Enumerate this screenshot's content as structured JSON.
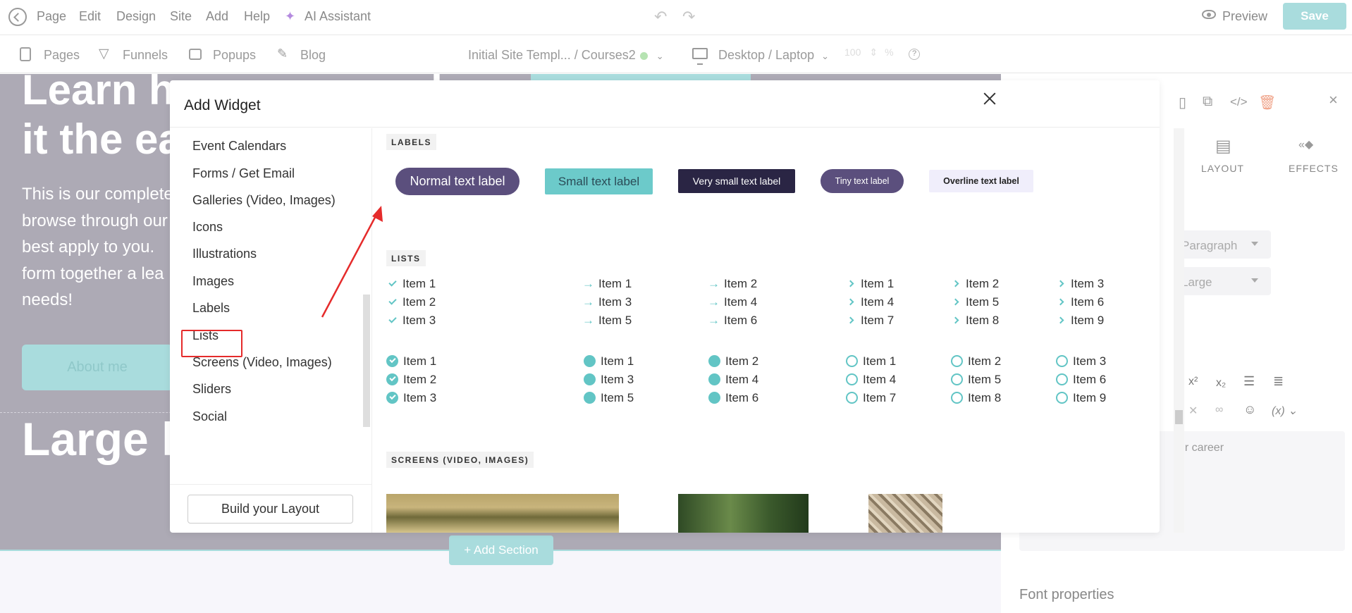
{
  "topbar": {
    "menu": [
      "Page",
      "Edit",
      "Design",
      "Site",
      "Add",
      "Help"
    ],
    "ai_assistant": "AI Assistant",
    "preview": "Preview",
    "save": "Save"
  },
  "subbar": {
    "pages": "Pages",
    "funnels": "Funnels",
    "popups": "Popups",
    "blog": "Blog",
    "breadcrumb": "Initial Site Templ... / Courses2",
    "device": "Desktop / Laptop",
    "zoom_value": "100",
    "zoom_unit": "%",
    "help_icon": "?"
  },
  "canvas": {
    "hero_title": "Learn how you can do\nit the easy way",
    "hero_text": "This is our complete\nbrowse through our\nbest apply to you.\nform together a lea\nneeds!",
    "about_button": "About me",
    "large_title": "Large h",
    "add_section": "Add Section"
  },
  "right_panel": {
    "tab_layout": "LAYOUT",
    "tab_effects": "EFFECTS",
    "select_paragraph": "Paragraph",
    "select_size": "Large",
    "format_superscript": "x²",
    "format_subscript": "x₂",
    "format_variable": "(x)",
    "career_text": "ur career",
    "font_properties": "Font properties"
  },
  "modal": {
    "title": "Add Widget",
    "categories": [
      "Event Calendars",
      "Forms / Get Email",
      "Galleries (Video, Images)",
      "Icons",
      "Illustrations",
      "Images",
      "Labels",
      "Lists",
      "Screens (Video, Images)",
      "Sliders",
      "Social"
    ],
    "selected_category": "Labels",
    "build_layout": "Build your Layout",
    "sections": {
      "labels": "LABELS",
      "lists": "LISTS",
      "screens": "SCREENS (VIDEO, IMAGES)"
    },
    "labels": [
      "Normal text label",
      "Small text label",
      "Very small text label",
      "Tiny text label",
      "Overline text label"
    ],
    "list_rows": {
      "check": [
        "Item 1",
        "Item 2",
        "Item 3"
      ],
      "arrow_a": [
        "Item 1",
        "Item 3",
        "Item 5"
      ],
      "arrow_b": [
        "Item 2",
        "Item 4",
        "Item 6"
      ],
      "chev_a": [
        "Item 1",
        "Item 4",
        "Item 7"
      ],
      "chev_b": [
        "Item 2",
        "Item 5",
        "Item 8"
      ],
      "chev_c": [
        "Item 3",
        "Item 6",
        "Item 9"
      ],
      "ccheck": [
        "Item 1",
        "Item 2",
        "Item 3"
      ],
      "fcirc_a": [
        "Item 1",
        "Item 3",
        "Item 5"
      ],
      "fcirc_b": [
        "Item 2",
        "Item 4",
        "Item 6"
      ],
      "ocirc_a": [
        "Item 1",
        "Item 4",
        "Item 7"
      ],
      "ocirc_b": [
        "Item 2",
        "Item 5",
        "Item 8"
      ],
      "ocirc_c": [
        "Item 3",
        "Item 6",
        "Item 9"
      ]
    }
  },
  "colors": {
    "accent": "#a9dcdd",
    "teal": "#62c5c5",
    "purple": "#5b4f7d",
    "dark_navy": "#2a2544",
    "annotation_red": "#e52b2b"
  }
}
